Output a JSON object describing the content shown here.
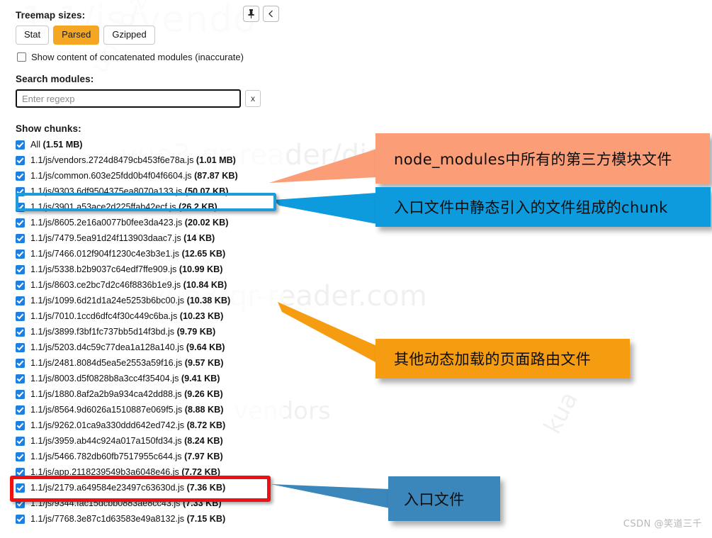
{
  "panel": {
    "buttons": [
      {
        "name": "pin-button",
        "icon": "pin-icon"
      },
      {
        "name": "collapse-button",
        "icon": "chevron-left-icon"
      }
    ],
    "treemap_sizes_label": "Treemap sizes:",
    "size_modes": [
      {
        "label": "Stat",
        "active": false
      },
      {
        "label": "Parsed",
        "active": true
      },
      {
        "label": "Gzipped",
        "active": false
      }
    ],
    "concat_modules_label": "Show content of concatenated modules (inaccurate)",
    "concat_modules_checked": false,
    "search_label": "Search modules:",
    "search_value": "",
    "search_placeholder": "Enter regexp",
    "clear_label": "x",
    "chunks_label": "Show chunks:"
  },
  "chunks": [
    {
      "name": "All",
      "size": "(1.51 MB)",
      "checked": true
    },
    {
      "name": "1.1/js/vendors.2724d8479cb453f6e78a.js",
      "size": "(1.01 MB)",
      "checked": true
    },
    {
      "name": "1.1/js/common.603e25fdd0b4f04f6604.js",
      "size": "(87.87 KB)",
      "checked": true
    },
    {
      "name": "1.1/js/9303.6df9504375ea8070a133.js",
      "size": "(50.07 KB)",
      "checked": true
    },
    {
      "name": "1.1/js/3901.a53ace2d225ffab42ecf.js",
      "size": "(26.2 KB)",
      "checked": true
    },
    {
      "name": "1.1/js/8605.2e16a0077b0fee3da423.js",
      "size": "(20.02 KB)",
      "checked": true
    },
    {
      "name": "1.1/js/7479.5ea91d24f113903daac7.js",
      "size": "(14 KB)",
      "checked": true
    },
    {
      "name": "1.1/js/7466.012f904f1230c4e3b3e1.js",
      "size": "(12.65 KB)",
      "checked": true
    },
    {
      "name": "1.1/js/5338.b2b9037c64edf7ffe909.js",
      "size": "(10.99 KB)",
      "checked": true
    },
    {
      "name": "1.1/js/8603.ce2bc7d2c46f8836b1e9.js",
      "size": "(10.84 KB)",
      "checked": true
    },
    {
      "name": "1.1/js/1099.6d21d1a24e5253b6bc00.js",
      "size": "(10.38 KB)",
      "checked": true
    },
    {
      "name": "1.1/js/7010.1ccd6dfc4f30c449c6ba.js",
      "size": "(10.23 KB)",
      "checked": true
    },
    {
      "name": "1.1/js/3899.f3bf1fc737bb5d14f3bd.js",
      "size": "(9.79 KB)",
      "checked": true
    },
    {
      "name": "1.1/js/5203.d4c59c77dea1a128a140.js",
      "size": "(9.64 KB)",
      "checked": true
    },
    {
      "name": "1.1/js/2481.8084d5ea5e2553a59f16.js",
      "size": "(9.57 KB)",
      "checked": true
    },
    {
      "name": "1.1/js/8003.d5f0828b8a3cc4f35404.js",
      "size": "(9.41 KB)",
      "checked": true
    },
    {
      "name": "1.1/js/1880.8af2a2b9a934ca42dd88.js",
      "size": "(9.26 KB)",
      "checked": true
    },
    {
      "name": "1.1/js/8564.9d6026a1510887e069f5.js",
      "size": "(8.88 KB)",
      "checked": true
    },
    {
      "name": "1.1/js/9262.01ca9a330ddd642ed742.js",
      "size": "(8.72 KB)",
      "checked": true
    },
    {
      "name": "1.1/js/3959.ab44c924a017a150fd34.js",
      "size": "(8.24 KB)",
      "checked": true
    },
    {
      "name": "1.1/js/5466.782db60fb7517955c644.js",
      "size": "(7.97 KB)",
      "checked": true
    },
    {
      "name": "1.1/js/app.2118239549b3a6048e46.js",
      "size": "(7.72 KB)",
      "checked": true
    },
    {
      "name": "1.1/js/2179.a649584e23497c63630d.js",
      "size": "(7.36 KB)",
      "checked": true
    },
    {
      "name": "1.1/js/9344.fac15dcbb0883ae8cc43.js",
      "size": "(7.33 KB)",
      "checked": true
    },
    {
      "name": "1.1/js/7768.3e87c1d63583e49a8132.js",
      "size": "(7.15 KB)",
      "checked": true
    }
  ],
  "annotations": [
    {
      "id": "vendors",
      "text": "node_modules中所有的第三方模块文件",
      "color": "#fb9d76"
    },
    {
      "id": "common",
      "text": "入口文件中静态引入的文件组成的chunk",
      "color": "#0d9bdd"
    },
    {
      "id": "dynamic",
      "text": "其他动态加载的页面路由文件",
      "color": "#f59c11"
    },
    {
      "id": "entry",
      "text": "入口文件",
      "color": "#3b86ba"
    }
  ],
  "highlights": [
    {
      "id": "common-highlight",
      "color": "#1e9bd8"
    },
    {
      "id": "entry-highlight",
      "color": "#ee1111"
    }
  ],
  "watermarks": {
    "line1": "1.1/js/vendo",
    "line2": "vue3-qr-reader/dist",
    "line3": "vue3-qr-reader.com",
    "line4": "vendors",
    "rot1": "ubiao.zh",
    "rot2": "kua",
    "rot3": "iao.zh"
  },
  "footer": {
    "credit": "CSDN @笑道三千"
  }
}
